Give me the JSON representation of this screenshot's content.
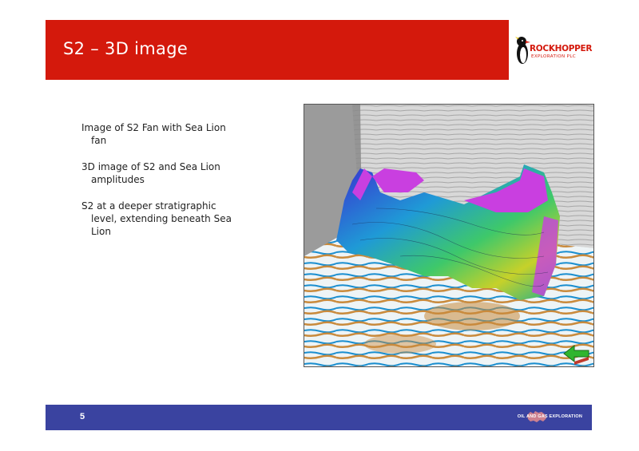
{
  "slide": {
    "title": "S2 – 3D image",
    "page_number": "5"
  },
  "logo": {
    "name": "ROCKHOPPER",
    "subtitle": "EXPLORATION PLC"
  },
  "bullets": [
    "Image of S2 Fan with Sea Lion fan",
    "3D image of S2 and Sea Lion amplitudes",
    "S2 at a deeper stratigraphic level, extending beneath Sea Lion"
  ],
  "footer": {
    "tagline": "OIL AND GAS EXPLORATION"
  },
  "colors": {
    "header": "#d4190c",
    "footer": "#3a43a0"
  },
  "image": {
    "icon": "seismic-3d-image"
  }
}
